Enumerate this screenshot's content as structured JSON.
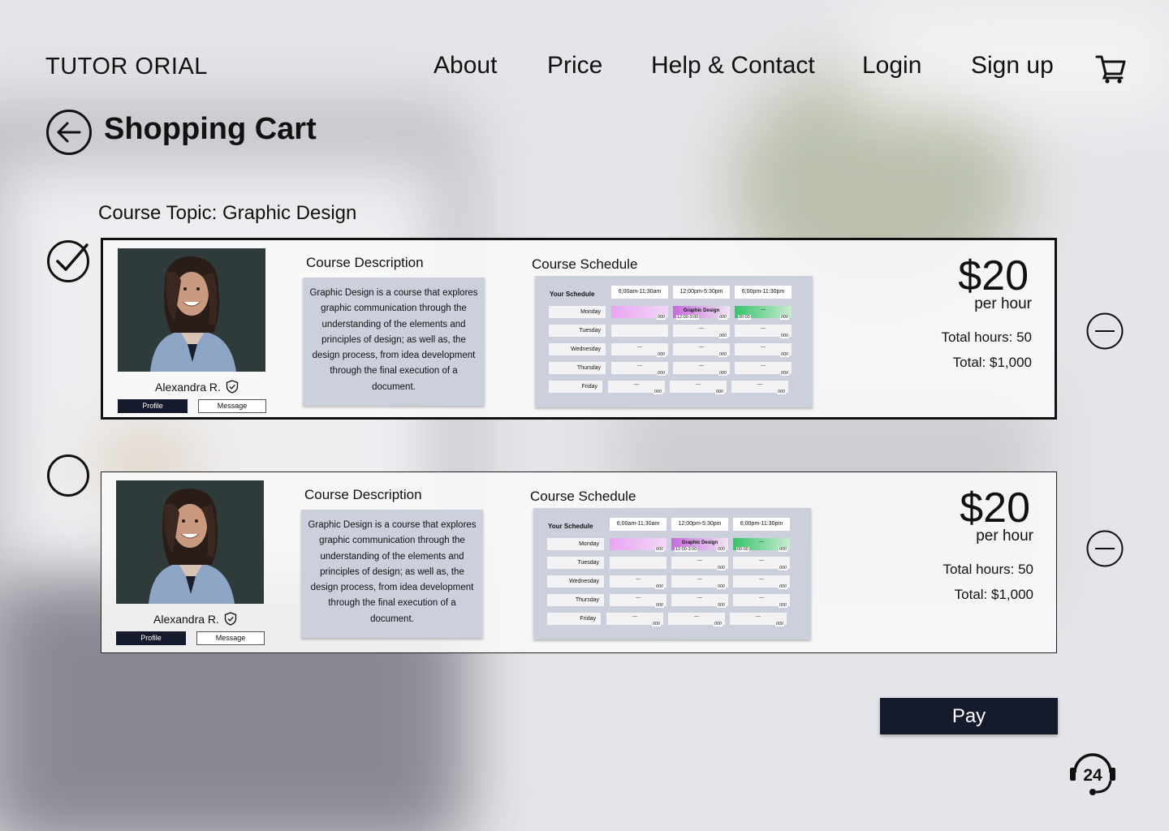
{
  "header": {
    "logo": "TUTOR ORIAL",
    "nav": [
      "About",
      "Price",
      "Help & Contact",
      "Login",
      "Sign up"
    ],
    "cart_icon": "cart-icon"
  },
  "page_title": "Shopping Cart",
  "course_topic": "Course Topic: Graphic Design",
  "cart_items": [
    {
      "selected": true,
      "tutor": {
        "name": "Alexandra R.",
        "verified_icon": "shield-check-icon"
      },
      "buttons": {
        "profile": "Profile",
        "message": "Message"
      },
      "description_title": "Course Description",
      "description": "Graphic Design is a course that explores graphic communication through the understanding of the elements and principles of design; as well as, the design process, from idea development through the final execution of a document.",
      "schedule_title": "Course Schedule",
      "price": "$20",
      "per_hour": "per hour",
      "total_hours": "Total hours: 50",
      "total": "Total: $1,000"
    },
    {
      "selected": false,
      "tutor": {
        "name": "Alexandra R.",
        "verified_icon": "shield-check-icon"
      },
      "buttons": {
        "profile": "Profile",
        "message": "Message"
      },
      "description_title": "Course Description",
      "description": "Graphic Design is a course that explores graphic communication through the understanding of the elements and principles of design; as well as, the design process, from idea development through the final execution of a document.",
      "schedule_title": "Course Schedule",
      "price": "$20",
      "per_hour": "per hour",
      "total_hours": "Total hours: 50",
      "total": "Total: $1,000"
    }
  ],
  "schedule": {
    "label": "Your Schedule",
    "slots": [
      "6;00am-11;30am",
      "12;00pm-5:30pm",
      "6;00pm-11:30pm"
    ],
    "days": [
      "Monday",
      "Tuesday",
      "Wednesday",
      "Thursday",
      "Friday"
    ],
    "empty_cell": "---",
    "cell_num": "000",
    "booked_course": "Graphic Design",
    "booked_time": "12:00-3:00",
    "evening_time": "00:00",
    "marks": [
      "*",
      "*",
      "*"
    ]
  },
  "pay_button": "Pay",
  "support_icon": "24-hour-support-icon",
  "colors": {
    "dark_navy": "#151a2c",
    "panel": "#ccd0dc",
    "pink": "#e9a4f3",
    "purple": "#c66bdc",
    "green": "#36c46a"
  }
}
